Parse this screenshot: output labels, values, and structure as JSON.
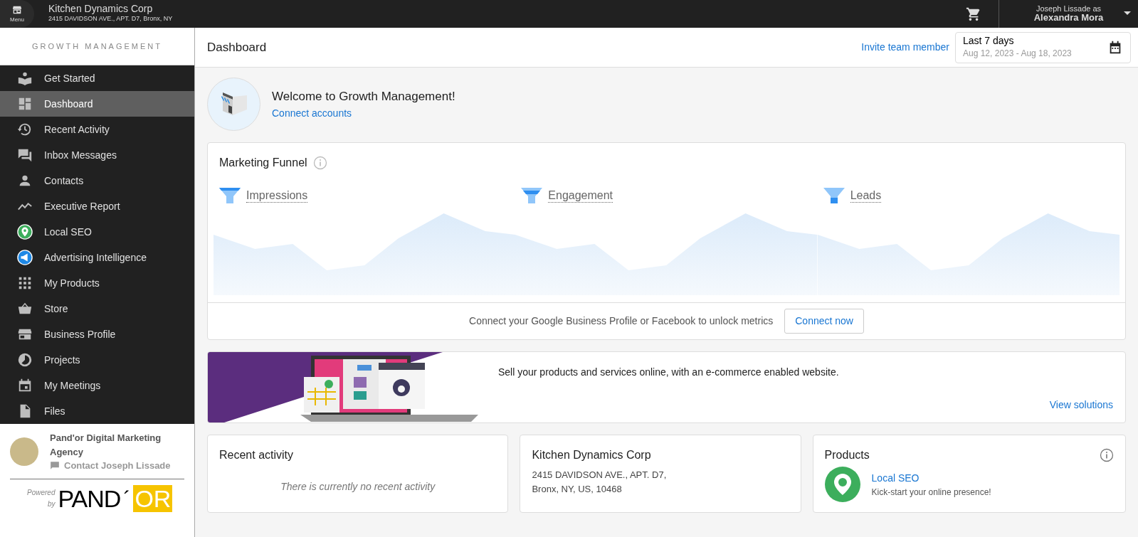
{
  "topbar": {
    "menu_label": "Menu",
    "company": "Kitchen Dynamics Corp",
    "address": "2415 DAVIDSON AVE., APT. D7, Bronx, NY",
    "user_line": "Joseph Lissade as",
    "user_name": "Alexandra Mora"
  },
  "sidebar": {
    "heading": "GROWTH MANAGEMENT",
    "items": [
      {
        "label": "Get Started",
        "selected": false
      },
      {
        "label": "Dashboard",
        "selected": true
      },
      {
        "label": "Recent Activity",
        "selected": false
      },
      {
        "label": "Inbox Messages",
        "selected": false
      },
      {
        "label": "Contacts",
        "selected": false
      },
      {
        "label": "Executive Report",
        "selected": false
      },
      {
        "label": "Local SEO",
        "selected": false
      },
      {
        "label": "Advertising Intelligence",
        "selected": false
      },
      {
        "label": "My Products",
        "selected": false
      },
      {
        "label": "Store",
        "selected": false
      },
      {
        "label": "Business Profile",
        "selected": false
      },
      {
        "label": "Projects",
        "selected": false
      },
      {
        "label": "My Meetings",
        "selected": false
      },
      {
        "label": "Files",
        "selected": false
      }
    ],
    "agency": {
      "name": "Pand'or Digital Marketing Agency",
      "contact": "Contact Joseph Lissade",
      "powered": "Powered",
      "by": "by",
      "logo_left": "PAND",
      "logo_mark": "´",
      "logo_right": "OR"
    }
  },
  "header": {
    "title": "Dashboard",
    "invite": "Invite team member",
    "range_label": "Last 7 days",
    "range_dates": "Aug 12, 2023 - Aug 18, 2023"
  },
  "welcome": {
    "title": "Welcome to Growth Management!",
    "link": "Connect accounts"
  },
  "funnel": {
    "title": "Marketing Funnel",
    "stages": [
      {
        "label": "Impressions"
      },
      {
        "label": "Engagement"
      },
      {
        "label": "Leads"
      }
    ],
    "footer_text": "Connect your Google Business Profile or Facebook to unlock metrics",
    "button": "Connect now"
  },
  "banner": {
    "text": "Sell your products and services online, with an e-commerce enabled website.",
    "link": "View solutions"
  },
  "cards": [
    {
      "kind": "activity",
      "title": "Recent activity",
      "empty": "There is currently no recent activity"
    },
    {
      "kind": "address",
      "title": "Kitchen Dynamics Corp",
      "line_1": "2415 DAVIDSON AVE., APT. D7,",
      "line_2": "Bronx, NY, US, 10468"
    },
    {
      "kind": "products",
      "title": "Products",
      "product": "Local SEO",
      "tagline": "Kick-start your online presence!"
    }
  ]
}
